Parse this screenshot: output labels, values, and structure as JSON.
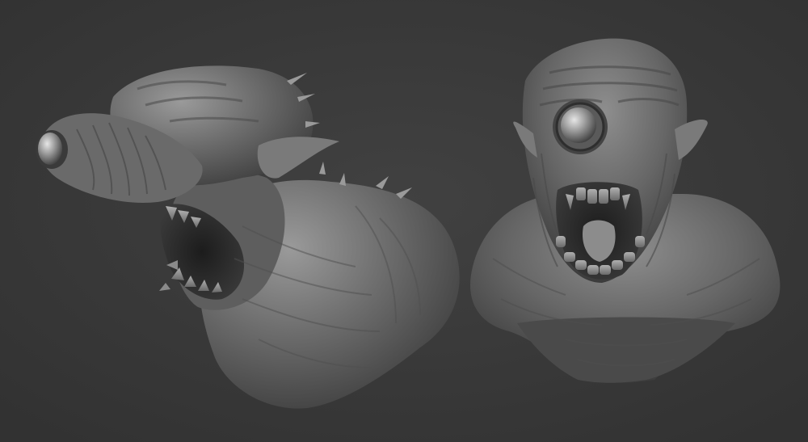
{
  "scene": {
    "background": "#3a3a3a",
    "material_base": "#707070",
    "material_light": "#a8a8a8",
    "material_shadow": "#262626",
    "subjects": [
      {
        "name": "creature-bust-side-view"
      },
      {
        "name": "creature-bust-front-view"
      }
    ]
  }
}
